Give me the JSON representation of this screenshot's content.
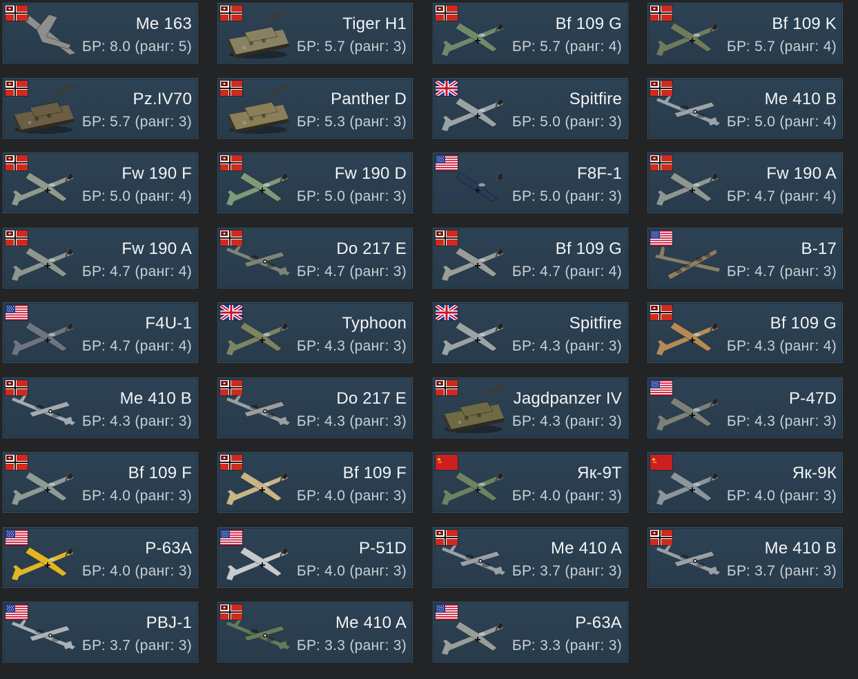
{
  "vehicles": [
    {
      "name": "Me 163",
      "br": "БР: 8.0 (ранг: 5)",
      "nation": "germany",
      "kind": "jet",
      "color": "#8e8f8c"
    },
    {
      "name": "Tiger H1",
      "br": "БР: 5.7 (ранг: 3)",
      "nation": "germany",
      "kind": "tank",
      "color": "#8a8163"
    },
    {
      "name": "Bf 109 G",
      "br": "БР: 5.7 (ранг: 4)",
      "nation": "germany",
      "kind": "plane",
      "color": "#6f8a6a"
    },
    {
      "name": "Bf 109 K",
      "br": "БР: 5.7 (ранг: 4)",
      "nation": "germany",
      "kind": "plane",
      "color": "#707a5d"
    },
    {
      "name": "Pz.IV70",
      "br": "БР: 5.7 (ранг: 3)",
      "nation": "germany",
      "kind": "tank",
      "color": "#6b5e44"
    },
    {
      "name": "Panther D",
      "br": "БР: 5.3 (ранг: 3)",
      "nation": "germany",
      "kind": "tank",
      "color": "#8b7f59"
    },
    {
      "name": "Spitfire",
      "br": "БР: 5.0 (ранг: 3)",
      "nation": "britain",
      "kind": "plane",
      "color": "#9aa3a6"
    },
    {
      "name": "Me 410 B",
      "br": "БР: 5.0 (ранг: 4)",
      "nation": "germany",
      "kind": "twin",
      "color": "#9aa2a8"
    },
    {
      "name": "Fw 190 F",
      "br": "БР: 5.0 (ранг: 4)",
      "nation": "germany",
      "kind": "plane",
      "color": "#8f9a8c"
    },
    {
      "name": "Fw 190 D",
      "br": "БР: 5.0 (ранг: 3)",
      "nation": "germany",
      "kind": "plane",
      "color": "#7e9a77"
    },
    {
      "name": "F8F-1",
      "br": "БР: 5.0 (ранг: 3)",
      "nation": "usa",
      "kind": "plane",
      "color": "#2c3a55"
    },
    {
      "name": "Fw 190 A",
      "br": "БР: 4.7 (ранг: 4)",
      "nation": "germany",
      "kind": "plane",
      "color": "#8e9690"
    },
    {
      "name": "Fw 190 A",
      "br": "БР: 4.7 (ранг: 4)",
      "nation": "germany",
      "kind": "plane",
      "color": "#8e9690"
    },
    {
      "name": "Do 217 E",
      "br": "БР: 4.7 (ранг: 3)",
      "nation": "germany",
      "kind": "twin",
      "color": "#7d8478"
    },
    {
      "name": "Bf 109 G",
      "br": "БР: 4.7 (ранг: 4)",
      "nation": "germany",
      "kind": "plane",
      "color": "#9a9e98"
    },
    {
      "name": "B-17",
      "br": "БР: 4.7 (ранг: 3)",
      "nation": "usa",
      "kind": "bomber",
      "color": "#8c7e66"
    },
    {
      "name": "F4U-1",
      "br": "БР: 4.7 (ранг: 4)",
      "nation": "usa",
      "kind": "plane",
      "color": "#6d7680"
    },
    {
      "name": "Typhoon",
      "br": "БР: 4.3 (ранг: 3)",
      "nation": "britain",
      "kind": "plane",
      "color": "#7c8460"
    },
    {
      "name": "Spitfire",
      "br": "БР: 4.3 (ранг: 3)",
      "nation": "britain",
      "kind": "plane",
      "color": "#9aa3a6"
    },
    {
      "name": "Bf 109 G",
      "br": "БР: 4.3 (ранг: 4)",
      "nation": "germany",
      "kind": "plane",
      "color": "#b58a55"
    },
    {
      "name": "Me 410 B",
      "br": "БР: 4.3 (ранг: 3)",
      "nation": "germany",
      "kind": "twin",
      "color": "#a3aab0"
    },
    {
      "name": "Do 217 E",
      "br": "БР: 4.3 (ранг: 3)",
      "nation": "germany",
      "kind": "twin",
      "color": "#9a9e9e"
    },
    {
      "name": "Jagdpanzer IV",
      "br": "БР: 4.3 (ранг: 3)",
      "nation": "germany",
      "kind": "tank",
      "color": "#6e6a44"
    },
    {
      "name": "P-47D",
      "br": "БР: 4.3 (ранг: 3)",
      "nation": "usa",
      "kind": "plane",
      "color": "#7c8078"
    },
    {
      "name": "Bf 109 F",
      "br": "БР: 4.0 (ранг: 3)",
      "nation": "germany",
      "kind": "plane",
      "color": "#8f9a94"
    },
    {
      "name": "Bf 109 F",
      "br": "БР: 4.0 (ранг: 3)",
      "nation": "germany",
      "kind": "plane",
      "color": "#c9b486"
    },
    {
      "name": "Як-9Т",
      "br": "БР: 4.0 (ранг: 3)",
      "nation": "ussr",
      "kind": "plane",
      "color": "#6d8262"
    },
    {
      "name": "Як-9К",
      "br": "БР: 4.0 (ранг: 3)",
      "nation": "ussr",
      "kind": "plane",
      "color": "#8c959c"
    },
    {
      "name": "P-63A",
      "br": "БР: 4.0 (ранг: 3)",
      "nation": "usa",
      "kind": "plane",
      "color": "#e2b623"
    },
    {
      "name": "P-51D",
      "br": "БР: 4.0 (ранг: 3)",
      "nation": "usa",
      "kind": "plane",
      "color": "#c6cacd"
    },
    {
      "name": "Me 410 A",
      "br": "БР: 3.7 (ранг: 3)",
      "nation": "germany",
      "kind": "twin",
      "color": "#9aa0a4"
    },
    {
      "name": "Me 410 B",
      "br": "БР: 3.7 (ранг: 3)",
      "nation": "germany",
      "kind": "twin",
      "color": "#9aa0a4"
    },
    {
      "name": "PBJ-1",
      "br": "БР: 3.7 (ранг: 3)",
      "nation": "usa",
      "kind": "twin",
      "color": "#aab2b8"
    },
    {
      "name": "Me 410 A",
      "br": "БР: 3.3 (ранг: 3)",
      "nation": "germany",
      "kind": "twin",
      "color": "#667a5c"
    },
    {
      "name": "P-63A",
      "br": "БР: 3.3 (ранг: 3)",
      "nation": "usa",
      "kind": "plane",
      "color": "#9a9c98"
    }
  ]
}
